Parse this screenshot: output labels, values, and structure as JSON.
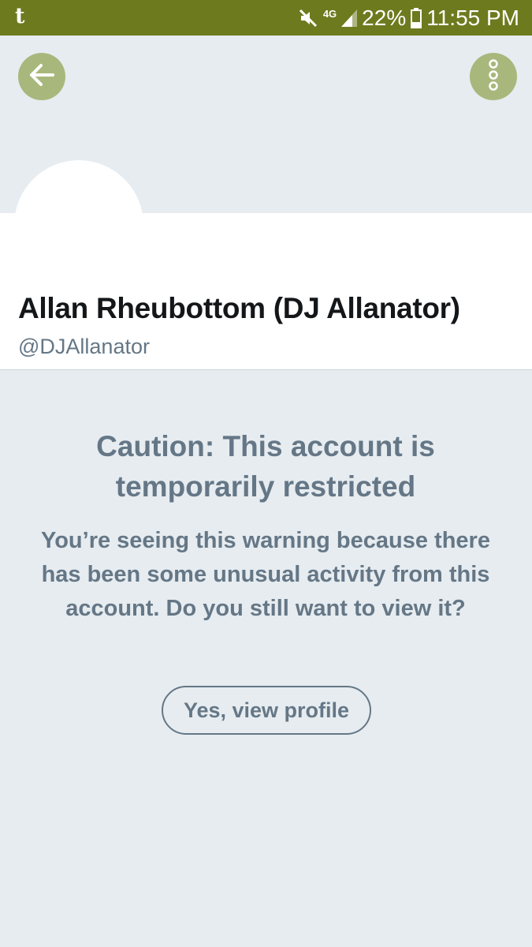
{
  "status_bar": {
    "app_glyph": "t",
    "network": "4G",
    "battery": "22%",
    "time": "11:55 PM",
    "icons": [
      "mute-icon",
      "network-4g-icon",
      "signal-icon",
      "battery-icon"
    ]
  },
  "header": {
    "back_icon": "arrow-left-icon",
    "more_icon": "vertical-dots-icon"
  },
  "profile": {
    "display_name": "Allan Rheubottom (DJ Allanator)",
    "handle": "@DJAllanator"
  },
  "warning": {
    "title": "Caution: This account is temporarily restricted",
    "body": "You’re seeing this warning because there has been some unusual activity from this account. Do you still want to view it?",
    "button_label": "Yes, view profile"
  },
  "colors": {
    "status_bar_bg": "#6e7a1e",
    "accent_circle": "#a8b87c",
    "background": "#e6ecf0",
    "muted_text": "#657786",
    "name_text": "#14171a"
  }
}
